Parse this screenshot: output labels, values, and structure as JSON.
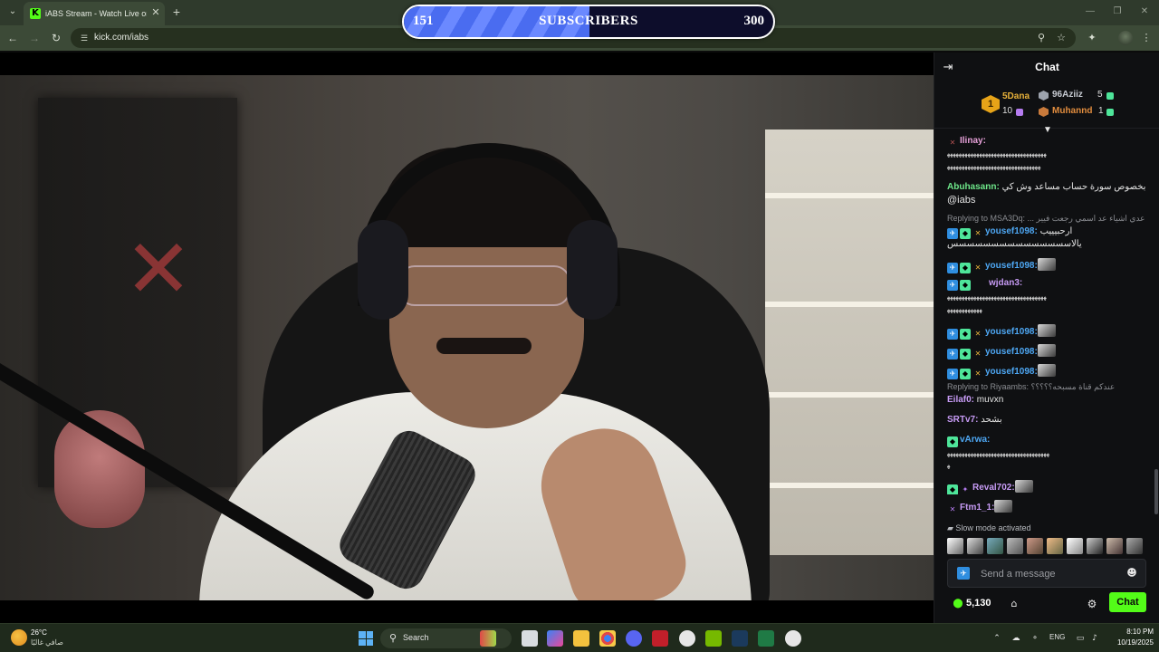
{
  "browser": {
    "tab_title": "iABS Stream - Watch Live on Kick",
    "tab_favicon_letter": "K",
    "url": "kick.com/iabs"
  },
  "subscriber_goal": {
    "current": "151",
    "label": "SUBSCRIBERS",
    "target": "300",
    "progress_fraction": 0.503
  },
  "chat": {
    "title": "Chat",
    "leaderboard": {
      "first": {
        "name": "5Dana",
        "count": "10",
        "rank": "1"
      },
      "second": {
        "name": "96Aziiz",
        "count": "5"
      },
      "third": {
        "name": "Muhannd",
        "count": "1"
      }
    },
    "messages": [
      {
        "user": "Ilinay:",
        "text": "",
        "user_color": "#e6a0d8"
      },
      {
        "user": "",
        "text": "ﻬﻬﻬﻬﻬﻬﻬﻬﻬﻬﻬﻬﻬﻬﻬﻬﻬﻬﻬﻬﻬﻬﻬﻬﻬﻬﻬﻬﻬﻬﻬﻬﻬﻬ"
      },
      {
        "user": "",
        "text": "ﻬﻬﻬﻬﻬﻬﻬﻬﻬﻬﻬﻬﻬﻬﻬﻬﻬﻬﻬﻬﻬﻬﻬﻬﻬﻬﻬﻬﻬﻬﻬﻬ"
      },
      {
        "user": "Abuhasann:",
        "text": "بخصوص سورة حساب مساعد وش كي",
        "user_color": "#6ee78a"
      },
      {
        "user": "",
        "text": "@iabs"
      },
      {
        "user": "yousef1098:",
        "text": "ارحبيييب",
        "user_color": "#4ea8f5"
      },
      {
        "user": "",
        "text": "يالاسسسسسسسسسسسسسسس"
      },
      {
        "user": "yousef1098:",
        "text": "",
        "user_color": "#4ea8f5"
      },
      {
        "user": "wjdan3:",
        "text": "",
        "user_color": "#c79bf5"
      },
      {
        "user": "",
        "text": "ﻬﻬﻬﻬﻬﻬﻬﻬﻬﻬﻬﻬﻬﻬﻬﻬﻬﻬﻬﻬﻬﻬﻬﻬﻬﻬﻬﻬﻬﻬﻬﻬﻬﻬ"
      },
      {
        "user": "",
        "text": "ﻬﻬﻬﻬﻬﻬﻬﻬﻬﻬﻬﻬ"
      },
      {
        "user": "yousef1098:",
        "text": "",
        "user_color": "#4ea8f5"
      },
      {
        "user": "yousef1098:",
        "text": "",
        "user_color": "#4ea8f5"
      },
      {
        "user": "yousef1098:",
        "text": "",
        "user_color": "#4ea8f5"
      },
      {
        "user": "Eilaf0:",
        "text": "muvxn",
        "user_color": "#c79bf5"
      },
      {
        "user": "SRTv7:",
        "text": "بشحد",
        "user_color": "#c79bf5"
      },
      {
        "user": "vArwa:",
        "text": "",
        "user_color": "#4ea8f5"
      },
      {
        "user": "",
        "text": "ﻬﻬﻬﻬﻬﻬﻬﻬﻬﻬﻬﻬﻬﻬﻬﻬﻬﻬﻬﻬﻬﻬﻬﻬﻬﻬﻬﻬﻬﻬﻬﻬﻬﻬﻬ"
      },
      {
        "user": "",
        "text": "ﻬ"
      },
      {
        "user": "Reval702:",
        "text": "",
        "user_color": "#c79bf5"
      },
      {
        "user": "Ftm1_1:",
        "text": "",
        "user_color": "#c79bf5"
      }
    ],
    "replies": [
      {
        "text": "Replying to MSA3Dq: ... عدي اشياء عد اسمي رجعت فيير"
      },
      {
        "text": "Replying to Riyaambs: عندكم قناة مسبحه؟؟؟؟؟"
      }
    ],
    "slow_mode": "Slow mode activated",
    "input_placeholder": "Send a message",
    "points": "5,130",
    "send_label": "Chat"
  },
  "taskbar": {
    "weather_temp": "26°C",
    "weather_desc": "صافي غالبًا",
    "search_label": "Search",
    "language": "ENG",
    "time": "8:10 PM",
    "date": "10/19/2025"
  },
  "colors": {
    "kick_green": "#53fc18",
    "subscriber_bar": "#4a6cf0"
  }
}
